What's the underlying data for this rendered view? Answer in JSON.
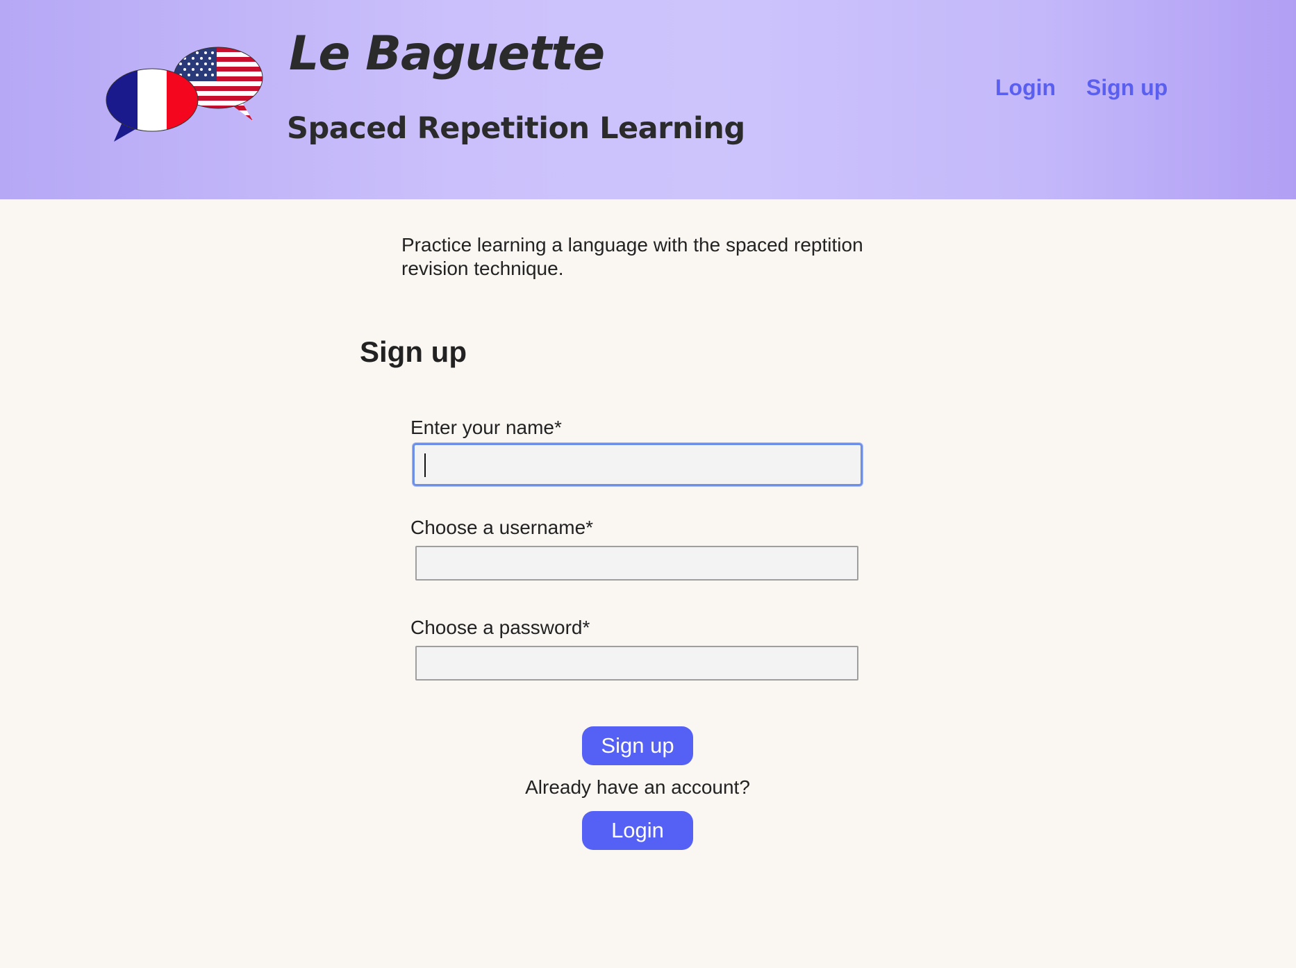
{
  "header": {
    "title": "Le Baguette",
    "subtitle": "Spaced Repetition Learning",
    "logo_icon": "speech-bubbles-france-usa-flags-icon",
    "nav": {
      "login_label": "Login",
      "signup_label": "Sign up"
    }
  },
  "main": {
    "intro_text": "Practice learning a language with the spaced reptition revision technique.",
    "section_title": "Sign up",
    "form": {
      "name_label": "Enter your name*",
      "name_value": "",
      "username_label": "Choose a username*",
      "username_value": "",
      "password_label": "Choose a password*",
      "password_value": "",
      "submit_label": "Sign up",
      "already_text": "Already have an account?",
      "login_label": "Login"
    }
  },
  "colors": {
    "header_gradient_start": "#b6a8f5",
    "header_gradient_mid": "#cdc4fc",
    "accent": "#5560f5",
    "link": "#5a5ff0",
    "background": "#faf7f3",
    "focus_ring": "#6d8fe6"
  }
}
